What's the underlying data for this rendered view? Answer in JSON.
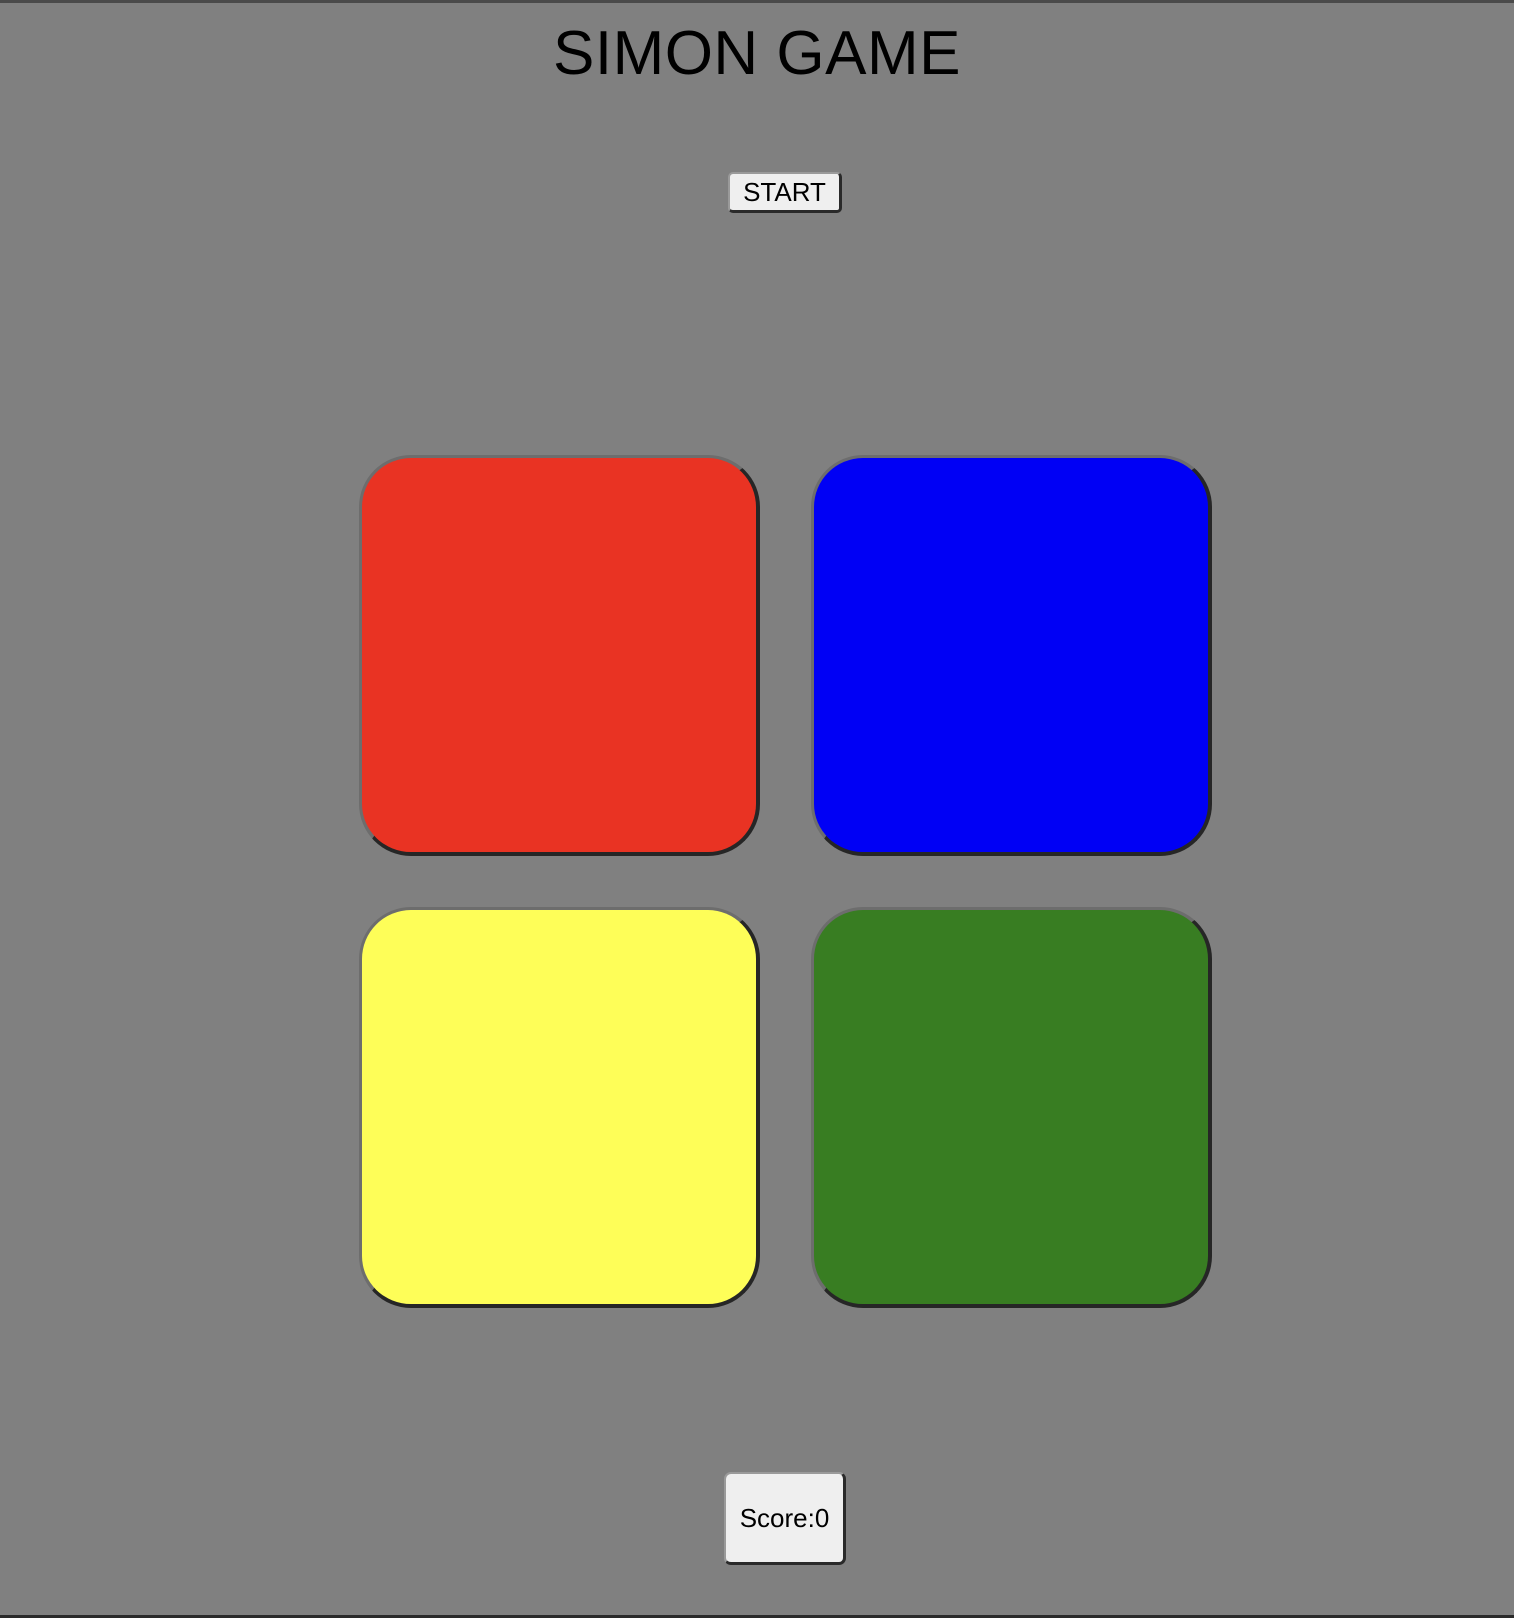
{
  "header": {
    "title": "SIMON GAME"
  },
  "controls": {
    "start_label": "START"
  },
  "pads": [
    {
      "id": "red",
      "color": "#e93323"
    },
    {
      "id": "blue",
      "color": "#0000f5"
    },
    {
      "id": "yellow",
      "color": "#fefe58"
    },
    {
      "id": "green",
      "color": "#387d22"
    }
  ],
  "status": {
    "score_label": "Score:",
    "score_value": "0",
    "score_text": "Score:0"
  },
  "colors": {
    "background": "#808080",
    "button_face": "#efefef"
  }
}
